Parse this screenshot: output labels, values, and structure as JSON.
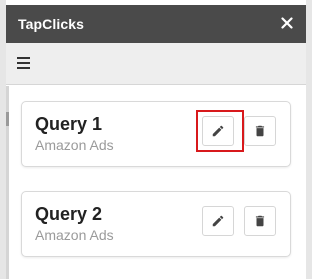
{
  "app": {
    "title": "TapClicks"
  },
  "queries": [
    {
      "name": "Query 1",
      "source": "Amazon Ads"
    },
    {
      "name": "Query 2",
      "source": "Amazon Ads"
    }
  ],
  "icons": {
    "close": "close-icon",
    "menu": "hamburger-menu-icon",
    "edit": "pencil-icon",
    "delete": "trash-icon"
  },
  "colors": {
    "titlebar": "#4a4a4a",
    "highlight": "#d8191c",
    "toolbar": "#eeeeee"
  }
}
